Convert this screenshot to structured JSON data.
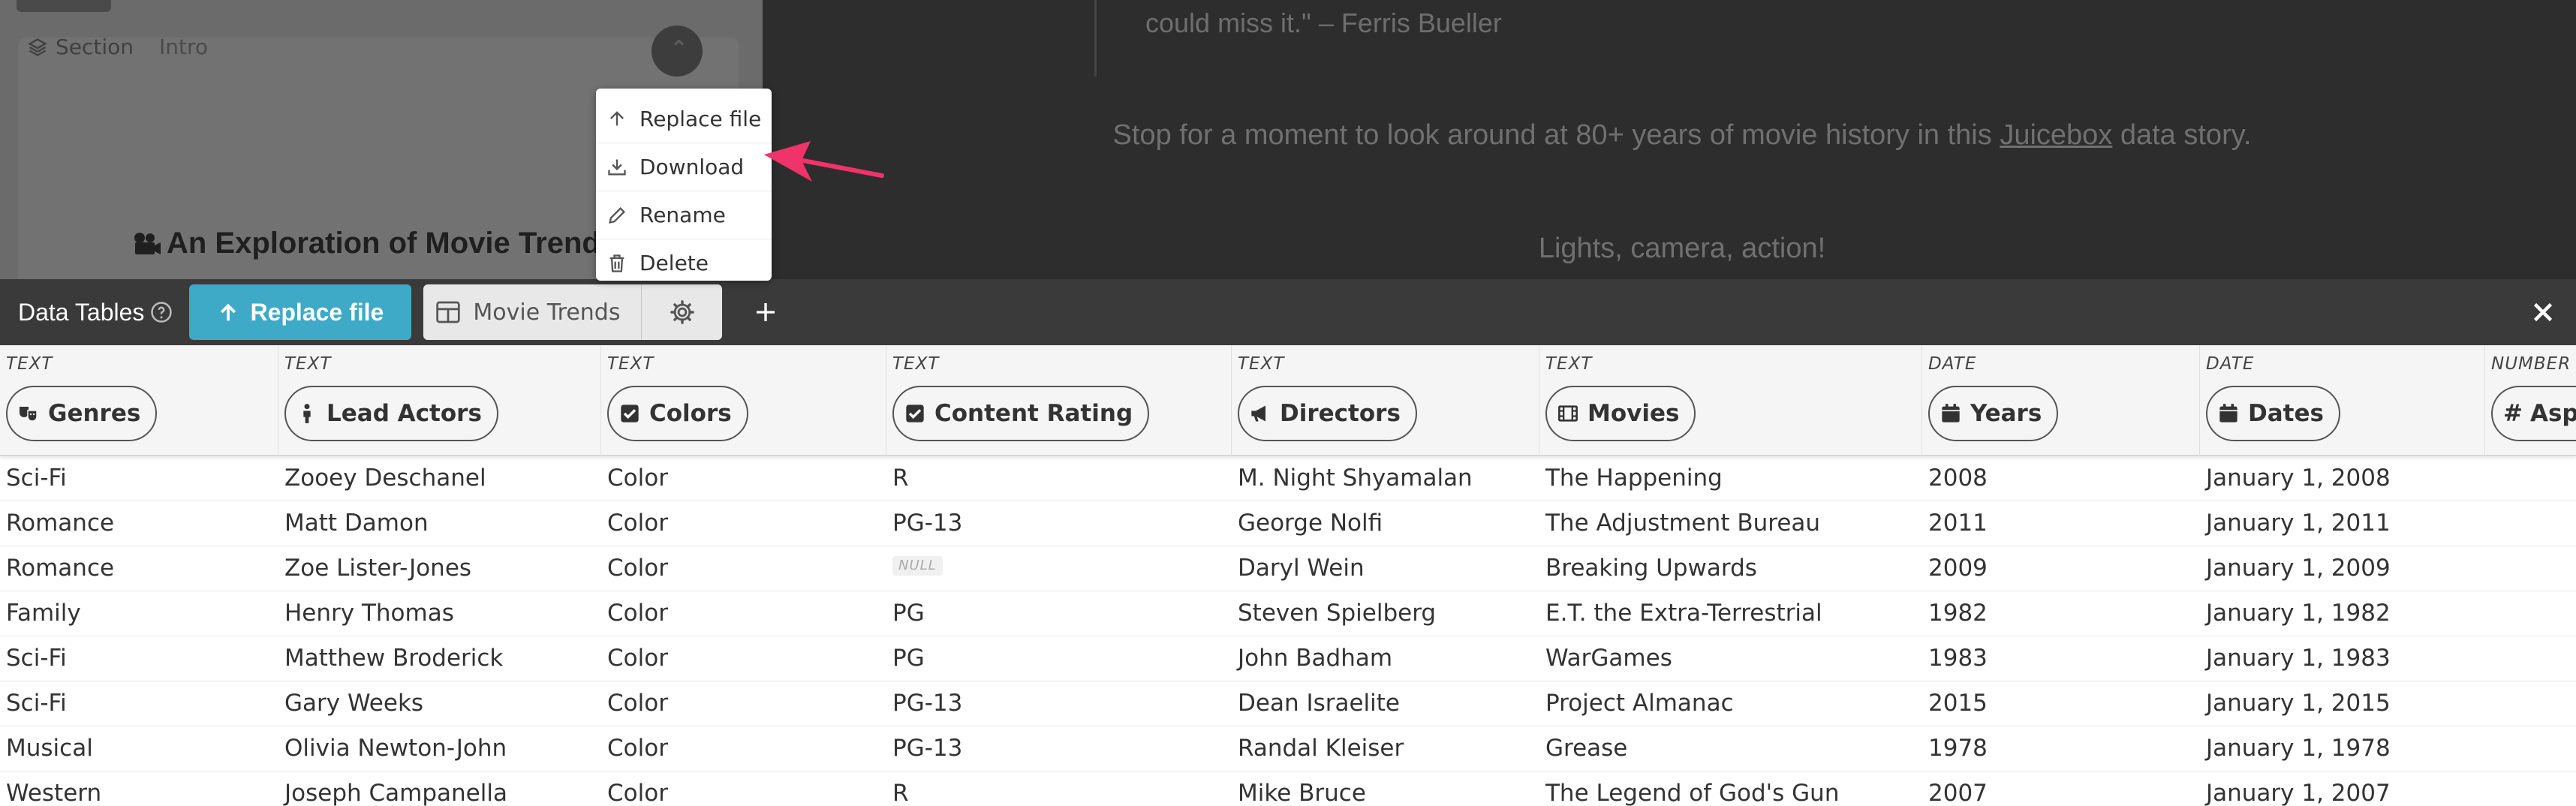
{
  "editor": {
    "section_label": "Section",
    "section_value": "Intro",
    "story_title": "An Exploration of Movie Trends"
  },
  "preview": {
    "quote_tail": "could miss it.\" – Ferris Bueller",
    "intro_before": "Stop for a moment to look around at 80+ years of movie history in this ",
    "intro_link": "Juicebox",
    "intro_after": " data story.",
    "lights": "Lights, camera, action!"
  },
  "context_menu": {
    "items": [
      "Replace file",
      "Download",
      "Rename",
      "Delete"
    ]
  },
  "colors": {
    "accent": "#3fa9c8",
    "callout_arrow": "#f0336b",
    "toolbar_bg": "#3a3a3a"
  },
  "toolbar": {
    "title": "Data Tables",
    "replace_label": "Replace file",
    "table_tab_label": "Movie Trends"
  },
  "table": {
    "columns": [
      {
        "type": "TEXT",
        "label": "Genres",
        "icon": "theater-masks-icon"
      },
      {
        "type": "TEXT",
        "label": "Lead Actors",
        "icon": "person-icon"
      },
      {
        "type": "TEXT",
        "label": "Colors",
        "icon": "checkbox-icon"
      },
      {
        "type": "TEXT",
        "label": "Content Rating",
        "icon": "checkbox-icon"
      },
      {
        "type": "TEXT",
        "label": "Directors",
        "icon": "megaphone-icon"
      },
      {
        "type": "TEXT",
        "label": "Movies",
        "icon": "film-icon"
      },
      {
        "type": "DATE",
        "label": "Years",
        "icon": "calendar-icon"
      },
      {
        "type": "DATE",
        "label": "Dates",
        "icon": "calendar-icon"
      },
      {
        "type": "NUMBER",
        "label": "Asp",
        "icon": "hash-icon"
      }
    ],
    "null_label": "NULL",
    "rows": [
      [
        "Sci-Fi",
        "Zooey Deschanel",
        "Color",
        "R",
        "M. Night Shyamalan",
        "The Happening",
        "2008",
        "January 1, 2008"
      ],
      [
        "Romance",
        "Matt Damon",
        "Color",
        "PG-13",
        "George Nolfi",
        "The Adjustment Bureau",
        "2011",
        "January 1, 2011"
      ],
      [
        "Romance",
        "Zoe Lister-Jones",
        "Color",
        null,
        "Daryl Wein",
        "Breaking Upwards",
        "2009",
        "January 1, 2009"
      ],
      [
        "Family",
        "Henry Thomas",
        "Color",
        "PG",
        "Steven Spielberg",
        "E.T. the Extra-Terrestrial",
        "1982",
        "January 1, 1982"
      ],
      [
        "Sci-Fi",
        "Matthew Broderick",
        "Color",
        "PG",
        "John Badham",
        "WarGames",
        "1983",
        "January 1, 1983"
      ],
      [
        "Sci-Fi",
        "Gary Weeks",
        "Color",
        "PG-13",
        "Dean Israelite",
        "Project Almanac",
        "2015",
        "January 1, 2015"
      ],
      [
        "Musical",
        "Olivia Newton-John",
        "Color",
        "PG-13",
        "Randal Kleiser",
        "Grease",
        "1978",
        "January 1, 1978"
      ],
      [
        "Western",
        "Joseph Campanella",
        "Color",
        "R",
        "Mike Bruce",
        "The Legend of God's Gun",
        "2007",
        "January 1, 2007"
      ]
    ]
  }
}
